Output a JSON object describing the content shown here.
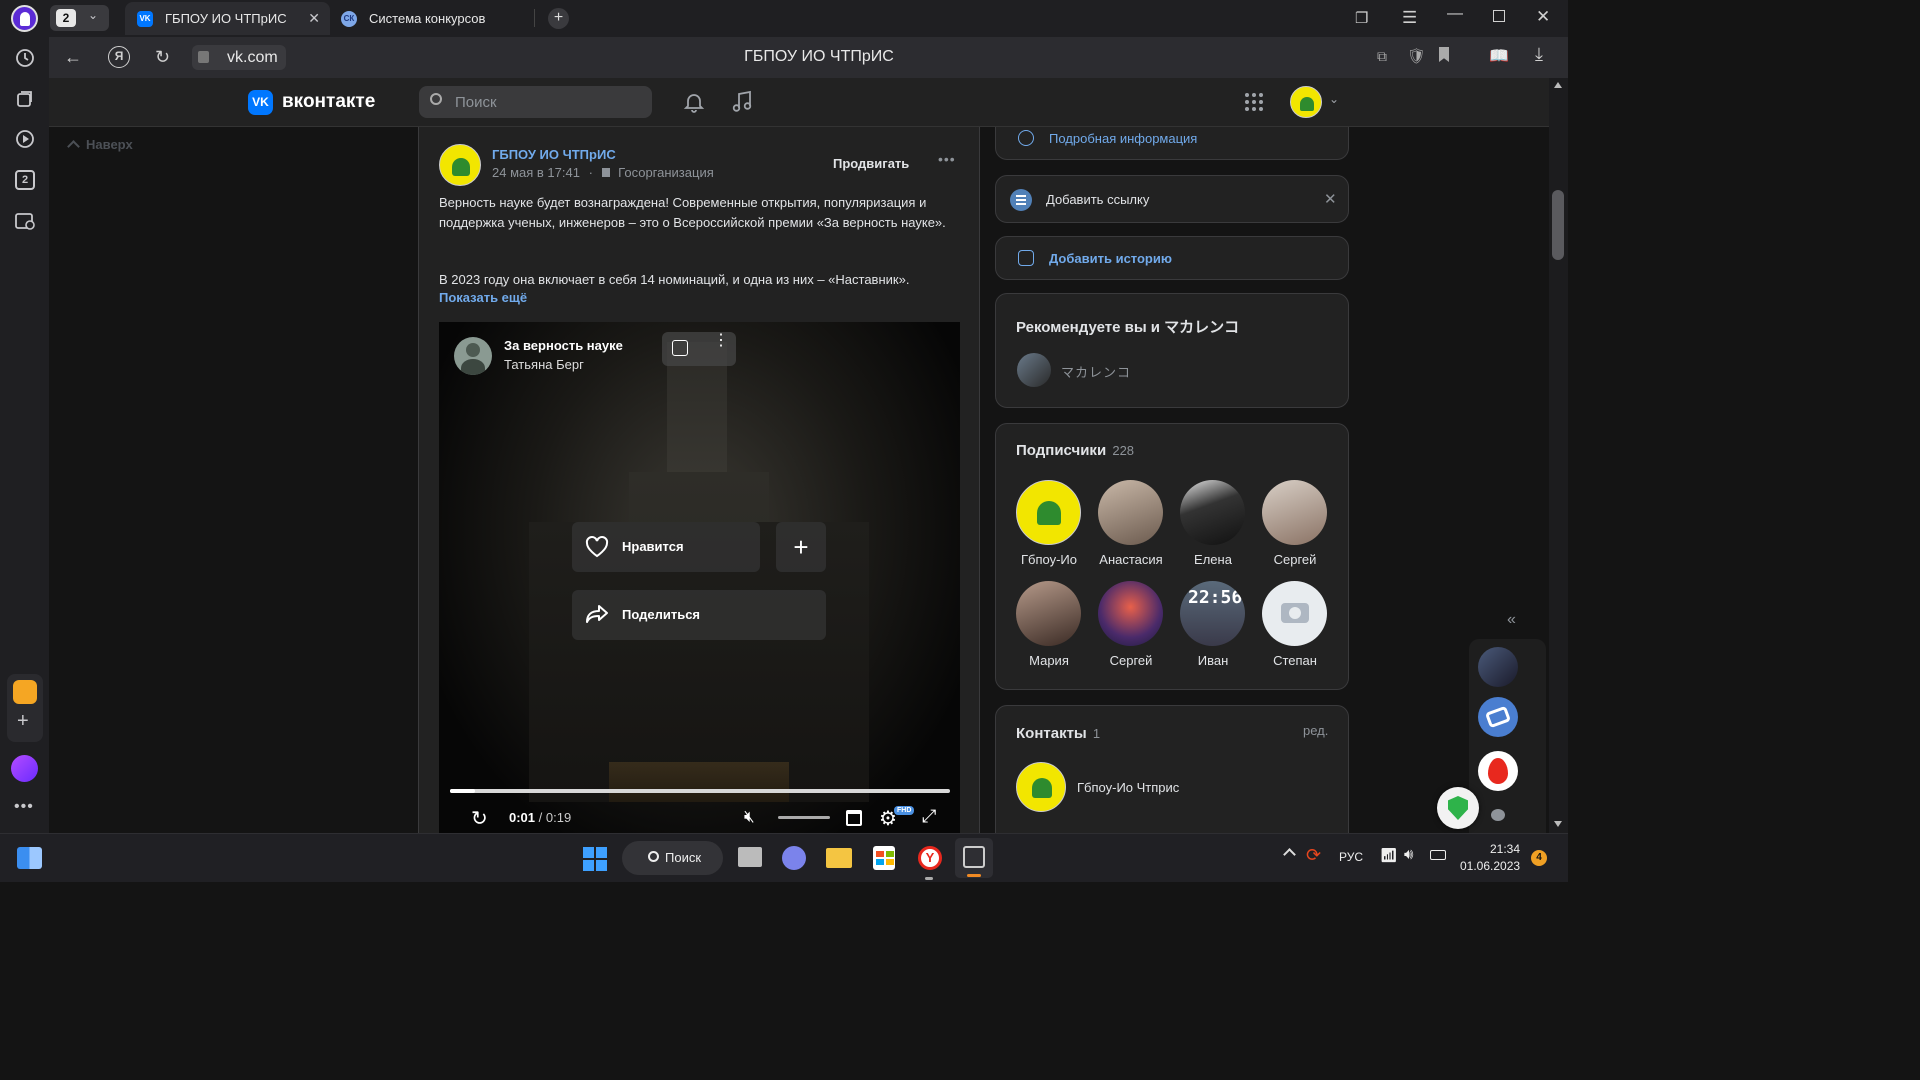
{
  "browser": {
    "tab_count": "2",
    "tabs": [
      {
        "label": "ГБПОУ ИО ЧТПрИС",
        "favicon": "VK"
      },
      {
        "label": "Система конкурсов",
        "favicon": "СК"
      }
    ],
    "url": "vk.com",
    "page_title": "ГБПОУ ИО ЧТПрИС",
    "sidebar_number": "2"
  },
  "vk_header": {
    "logo_text": "вконтакте",
    "search_placeholder": "Поиск"
  },
  "left": {
    "to_top": "Наверх"
  },
  "post": {
    "author": "ГБПОУ ИО ЧТПрИС",
    "date": "24 мая в 17:41",
    "category": "Госорганизация",
    "promote": "Продвигать",
    "text1": "Верность науке будет вознаграждена! Современные открытия, популяризация и поддержка ученых, инженеров – это о Всероссийской премии «За верность науке».",
    "text2": "В 2023 году она включает в себя 14 номинаций, и одна из них – «Наставник».",
    "show_more": "Показать ещё",
    "video": {
      "title": "За верность науке",
      "author": "Татьяна Берг",
      "like_label": "Нравится",
      "share_label": "Поделиться",
      "time_current": "0:01",
      "time_total": "/ 0:19",
      "progress": 0.05,
      "quality_badge": "FHD"
    }
  },
  "right": {
    "more_info": "Подробная информация",
    "add_link": "Добавить ссылку",
    "add_story": "Добавить историю",
    "recommend_title": "Рекомендуете вы и マカレンコ",
    "recommend_person": "マカレンコ",
    "subscribers_title": "Подписчики",
    "subscribers_count": "228",
    "subscribers": [
      {
        "name": "Гбпоу-Ио"
      },
      {
        "name": "Анастасия"
      },
      {
        "name": "Елена"
      },
      {
        "name": "Сергей"
      },
      {
        "name": "Мария"
      },
      {
        "name": "Сергей"
      },
      {
        "name": "Иван"
      },
      {
        "name": "Степан"
      }
    ],
    "contacts_title": "Контакты",
    "contacts_count": "1",
    "contacts_edit": "ред.",
    "contact_name": "Гбпоу-Ио Чтприс"
  },
  "taskbar": {
    "search_label": "Поиск",
    "lang": "РУС",
    "time": "21:34",
    "date": "01.06.2023",
    "notif_count": "4"
  },
  "colors": {
    "vk_blue": "#0077ff",
    "link": "#71aaeb",
    "card_bg": "#222222",
    "page_bg": "#141414"
  }
}
